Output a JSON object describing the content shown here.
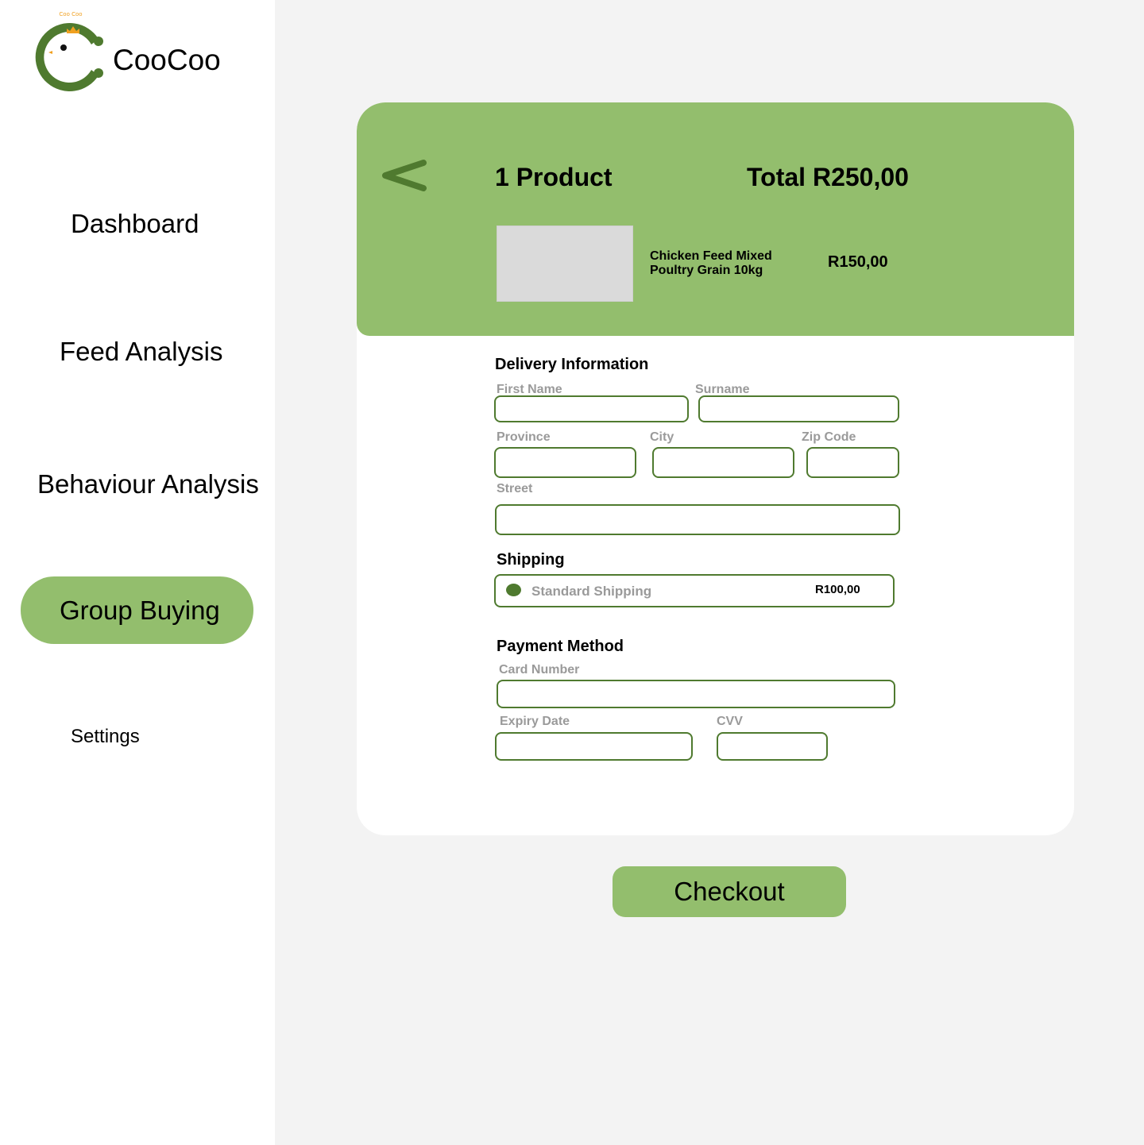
{
  "brand": {
    "name": "CooCoo",
    "logo_text": "Coo Coo",
    "colors": {
      "logo_green": "#4f7a2f",
      "crown": "#f0a020",
      "accent": "#93be6d"
    }
  },
  "sidebar": {
    "items": [
      {
        "label": "Dashboard",
        "active": false
      },
      {
        "label": "Feed Analysis",
        "active": false
      },
      {
        "label": "Behaviour Analysis",
        "active": false
      },
      {
        "label": "Group Buying",
        "active": true
      },
      {
        "label": "Settings",
        "active": false
      }
    ]
  },
  "cart": {
    "back_icon": "chevron-left-icon",
    "count_label": "1 Product",
    "total_label": "Total R250,00",
    "product": {
      "name_line1": "Chicken Feed Mixed",
      "name_line2": "Poultry Grain 10kg",
      "price": "R150,00"
    }
  },
  "delivery": {
    "title": "Delivery Information",
    "first_name": {
      "label": "First Name",
      "value": ""
    },
    "surname": {
      "label": "Surname",
      "value": ""
    },
    "province": {
      "label": "Province",
      "value": ""
    },
    "city": {
      "label": "City",
      "value": ""
    },
    "zip": {
      "label": "Zip Code",
      "value": ""
    },
    "street": {
      "label": "Street",
      "value": ""
    }
  },
  "shipping": {
    "title": "Shipping",
    "option_name": "Standard Shipping",
    "option_price": "R100,00",
    "selected": true
  },
  "payment": {
    "title": "Payment Method",
    "card_number": {
      "label": "Card Number",
      "value": ""
    },
    "expiry": {
      "label": "Expiry Date",
      "value": ""
    },
    "cvv": {
      "label": "CVV",
      "value": ""
    }
  },
  "checkout_label": "Checkout"
}
